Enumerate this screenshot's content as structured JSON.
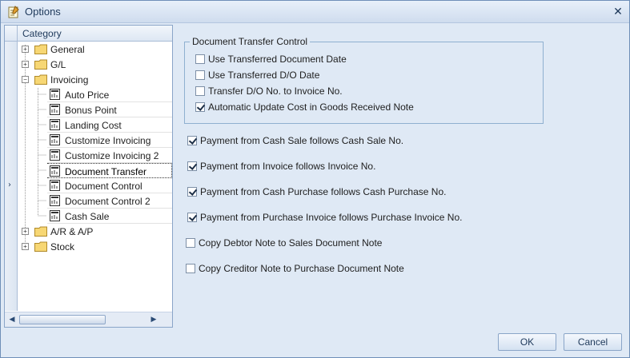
{
  "window": {
    "title": "Options"
  },
  "tree": {
    "header": "Category",
    "items": [
      {
        "label": "General",
        "level": 0,
        "expander": "+"
      },
      {
        "label": "G/L",
        "level": 0,
        "expander": "+"
      },
      {
        "label": "Invoicing",
        "level": 0,
        "expander": "−"
      },
      {
        "label": "Auto Price",
        "level": 1
      },
      {
        "label": "Bonus Point",
        "level": 1
      },
      {
        "label": "Landing Cost",
        "level": 1
      },
      {
        "label": "Customize Invoicing",
        "level": 1
      },
      {
        "label": "Customize Invoicing 2",
        "level": 1
      },
      {
        "label": "Document Transfer",
        "level": 1,
        "selected": true
      },
      {
        "label": "Document Control",
        "level": 1
      },
      {
        "label": "Document Control 2",
        "level": 1
      },
      {
        "label": "Cash Sale",
        "level": 1
      },
      {
        "label": "A/R & A/P",
        "level": 0,
        "expander": "+"
      },
      {
        "label": "Stock",
        "level": 0,
        "expander": "+"
      }
    ],
    "row_indicator": "›"
  },
  "document_transfer": {
    "legend": "Document Transfer Control",
    "options": [
      {
        "label": "Use Transferred Document Date",
        "checked": false
      },
      {
        "label": "Use Transferred D/O Date",
        "checked": false
      },
      {
        "label": "Transfer D/O No. to Invoice No.",
        "checked": false
      },
      {
        "label": "Automatic Update Cost in Goods Received Note",
        "checked": true
      }
    ]
  },
  "payments": [
    {
      "label": "Payment from Cash Sale follows Cash Sale No.",
      "checked": true
    },
    {
      "label": "Payment from Invoice follows Invoice No.",
      "checked": true
    },
    {
      "label": "Payment from Cash Purchase follows Cash Purchase No.",
      "checked": true
    },
    {
      "label": "Payment from Purchase Invoice follows Purchase Invoice No.",
      "checked": true
    },
    {
      "label": "Copy Debtor Note to Sales Document Note",
      "checked": false
    },
    {
      "label": "Copy Creditor Note to Purchase Document Note",
      "checked": false
    }
  ],
  "buttons": {
    "ok": "OK",
    "cancel": "Cancel"
  },
  "colors": {
    "window_bg": "#dfe9f5",
    "accent": "#1e395b",
    "border": "#8aa5c8",
    "folder": "#f2c94c"
  }
}
